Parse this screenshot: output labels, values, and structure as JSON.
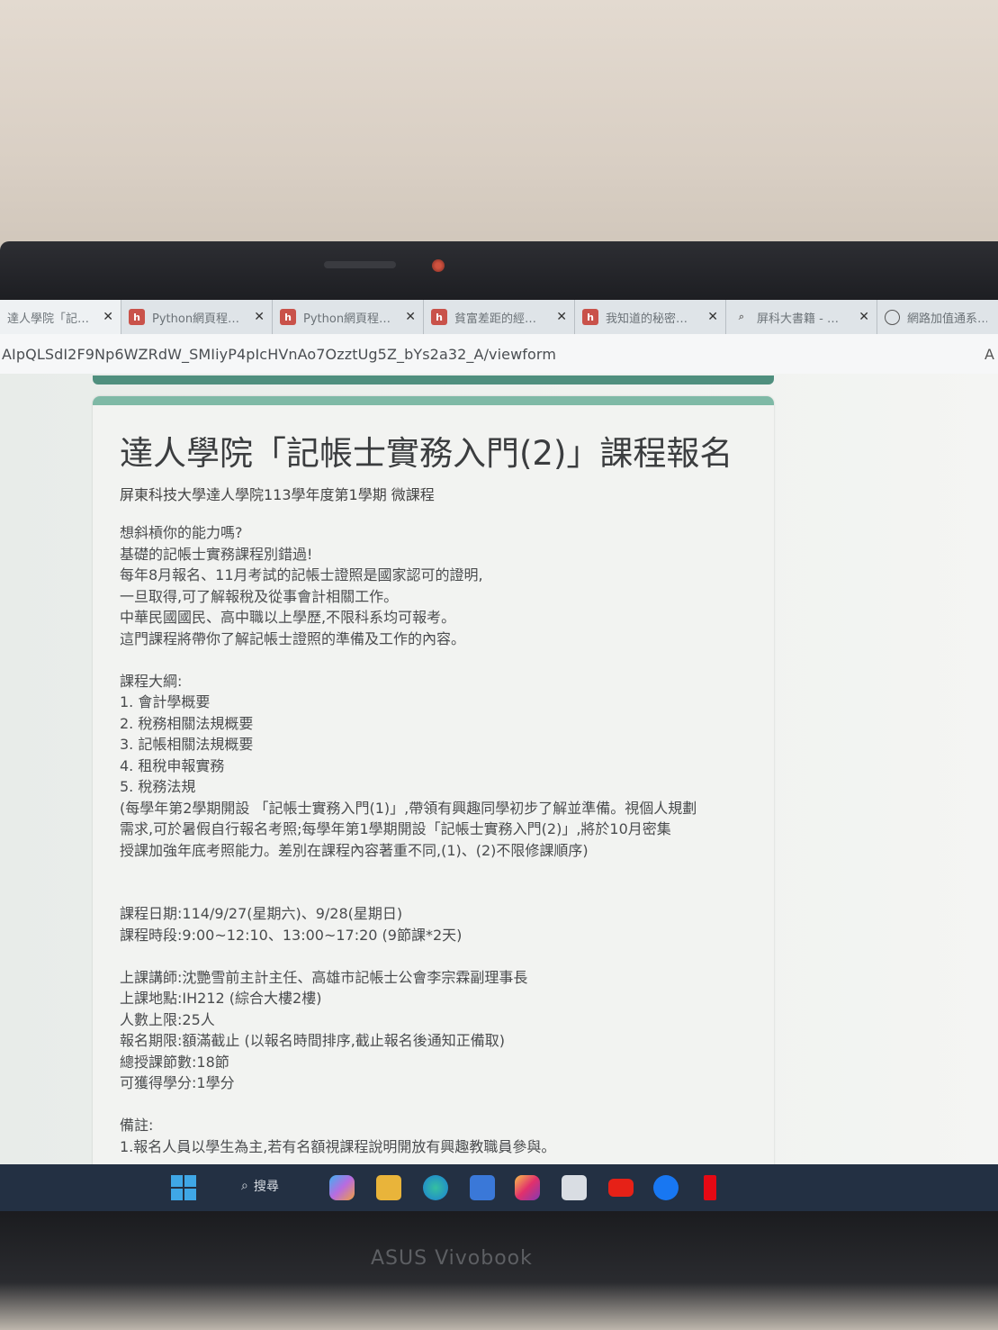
{
  "browser": {
    "tabs": [
      {
        "label": "達人學院「記…",
        "icon": "forms-icon"
      },
      {
        "label": "Python網頁程…",
        "icon": "hahow-icon"
      },
      {
        "label": "Python網頁程…",
        "icon": "hahow-icon"
      },
      {
        "label": "貧富差距的經…",
        "icon": "hahow-icon"
      },
      {
        "label": "我知道的秘密…",
        "icon": "hahow-icon"
      },
      {
        "label": "屏科大書籍 - …",
        "icon": "search-icon"
      },
      {
        "label": "網路加值通系…",
        "icon": "globe-icon"
      }
    ],
    "url": "AIpQLSdI2F9Np6WZRdW_SMIiyP4pIcHVnAo7OzztUg5Z_bYs2a32_A/viewform",
    "addr_right": "A"
  },
  "form": {
    "title": "達人學院「記帳士實務入門(2)」課程報名",
    "subtitle": "屏東科技大學達人學院113學年度第1學期 微課程",
    "intro": [
      "想斜槓你的能力嗎?",
      "基礎的記帳士實務課程別錯過!",
      "每年8月報名、11月考試的記帳士證照是國家認可的證明,",
      "一旦取得,可了解報稅及從事會計相關工作。",
      "中華民國國民、高中職以上學歷,不限科系均可報考。",
      "這門課程將帶你了解記帳士證照的準備及工作的內容。"
    ],
    "outline_heading": "課程大綱:",
    "outline": [
      "1. 會計學概要",
      "2. 稅務相關法規概要",
      "3. 記帳相關法規概要",
      "4. 租稅申報實務",
      "5. 稅務法規"
    ],
    "note_paren": [
      "(每學年第2學期開設 「記帳士實務入門(1)」,帶領有興趣同學初步了解並準備。視個人規劃",
      "需求,可於暑假自行報名考照;每學年第1學期開設「記帳士實務入門(2)」,將於10月密集",
      "授課加強年底考照能力。差別在課程內容著重不同,(1)、(2)不限修課順序)"
    ],
    "schedule": [
      "課程日期:114/9/27(星期六)、9/28(星期日)",
      "課程時段:9:00~12:10、13:00~17:20 (9節課*2天)"
    ],
    "details": [
      "上課講師:沈艷雪前主計主任、高雄市記帳士公會李宗霖副理事長",
      "上課地點:IH212 (綜合大樓2樓)",
      "人數上限:25人",
      "報名期限:額滿截止 (以報名時間排序,截止報名後通知正備取)",
      "總授課節數:18節",
      "可獲得學分:1學分"
    ],
    "remarks_heading": "備註:",
    "remarks": [
      "1.報名人員以學生為主,若有名額視課程說明開放有興趣教職員參與。"
    ]
  },
  "taskbar": {
    "search_label": "搜尋",
    "apps": [
      "copilot-icon",
      "file-explorer-icon",
      "edge-icon",
      "app-icon",
      "instagram-icon",
      "store-icon",
      "youtube-icon",
      "facebook-icon",
      "netflix-icon"
    ]
  },
  "laptop": {
    "brand": "ASUS Vivobook"
  }
}
